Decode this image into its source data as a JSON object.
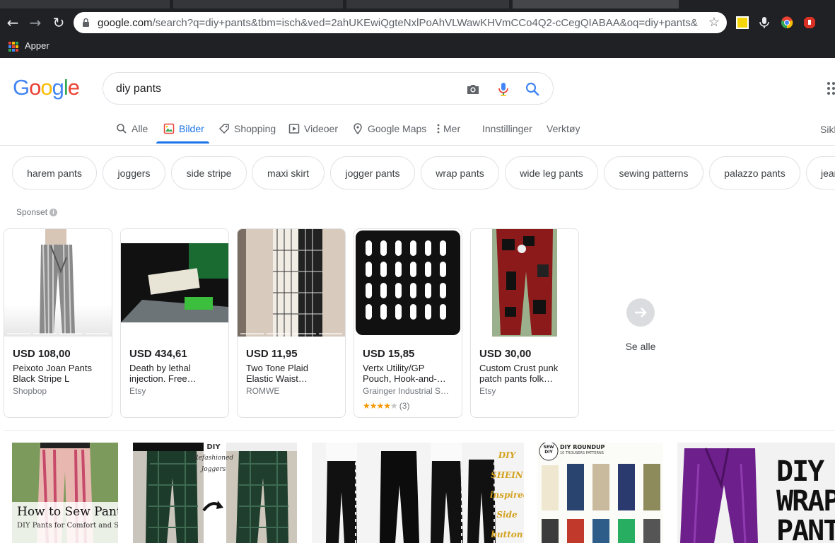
{
  "browser": {
    "url_host": "google.com",
    "url_rest": "/search?q=diy+pants&tbm=isch&ved=2ahUKEwiQgteNxlPoAhVLWawKHVmCCo4Q2-cCegQIABAA&oq=diy+pants&...",
    "bookmark": "Apper"
  },
  "search": {
    "query": "diy pants"
  },
  "logo": [
    "G",
    "o",
    "o",
    "g",
    "l",
    "e"
  ],
  "tabs": {
    "all": "Alle",
    "images": "Bilder",
    "shopping": "Shopping",
    "videos": "Videoer",
    "maps": "Google Maps",
    "more": "Mer",
    "settings": "Innstillinger",
    "tools": "Verktøy",
    "safesearch": "Sikk"
  },
  "chips": [
    "harem pants",
    "joggers",
    "side stripe",
    "maxi skirt",
    "jogger pants",
    "wrap pants",
    "wide leg pants",
    "sewing patterns",
    "palazzo pants",
    "jeans"
  ],
  "sponsored_label": "Sponset",
  "products": [
    {
      "price": "USD 108,00",
      "title1": "Peixoto Joan Pants",
      "title2": "Black Stripe L",
      "shop": "Shopbop"
    },
    {
      "price": "USD 434,61",
      "title1": "Death by lethal",
      "title2": "injection. Free…",
      "shop": "Etsy"
    },
    {
      "price": "USD 11,95",
      "title1": "Two Tone Plaid",
      "title2": "Elastic Waist…",
      "shop": "ROMWE"
    },
    {
      "price": "USD 15,85",
      "title1": "Vertx Utility/GP",
      "title2": "Pouch, Hook-and-…",
      "shop": "Grainger Industrial S…",
      "rating": 4,
      "reviews": "(3)"
    },
    {
      "price": "USD 30,00",
      "title1": "Custom Crust punk",
      "title2": "patch pants folk…",
      "shop": "Etsy"
    }
  ],
  "see_all": "Se alle",
  "results": [
    {
      "text1": "How to Sew Pants",
      "text2": "DIY Pants for Comfort and Style"
    },
    {
      "text1": "DIY",
      "text2": "Refashioned",
      "text3": "Joggers"
    },
    {
      "words": [
        "DIY",
        "SHEIN",
        "inspired",
        "Side",
        "button"
      ]
    },
    {
      "badge": "SEW DIY",
      "title": "DIY ROUNDUP",
      "subtitle": "10 TROUSERS PATTERNS"
    },
    {
      "text1": "DIY",
      "text2": "WRAP",
      "text3": "PANTS"
    }
  ],
  "colors": {
    "blue": "#4285f4",
    "red": "#ea4335",
    "yellow": "#fbbc05",
    "green": "#34a853",
    "accent": "#1a73e8"
  }
}
